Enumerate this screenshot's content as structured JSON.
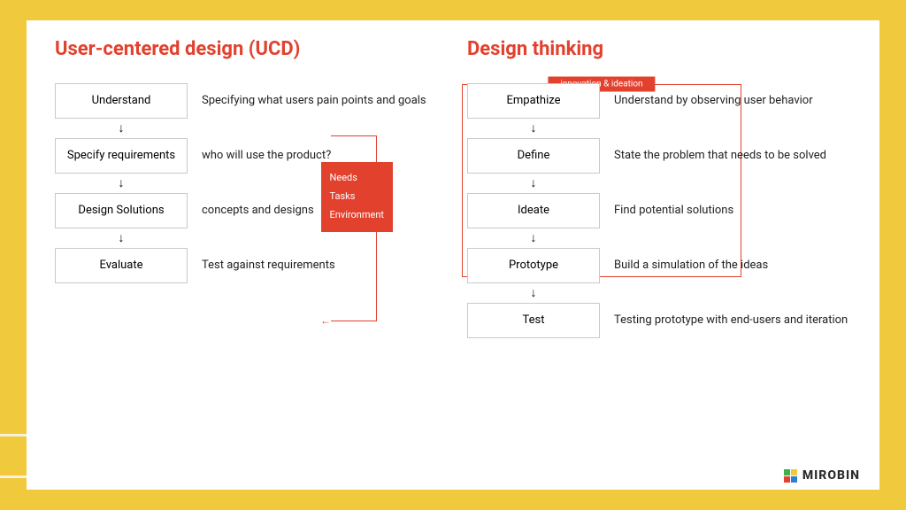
{
  "ucd": {
    "title": "User-centered design (UCD)",
    "steps": [
      {
        "label": "Understand",
        "desc": "Specifying what users pain points and goals"
      },
      {
        "label": "Specify requirements",
        "desc": "who will use the product?"
      },
      {
        "label": "Design Solutions",
        "desc": "concepts and designs"
      },
      {
        "label": "Evaluate",
        "desc": "Test against requirements"
      }
    ],
    "feedback_box": {
      "line1": "Needs",
      "line2": "Tasks",
      "line3": "Environment"
    }
  },
  "dt": {
    "title": "Design thinking",
    "group_label": "innovation & ideation",
    "steps": [
      {
        "label": "Empathize",
        "desc": "Understand by observing user behavior"
      },
      {
        "label": "Define",
        "desc": "State the problem that needs to be solved"
      },
      {
        "label": "Ideate",
        "desc": "Find potential solutions"
      },
      {
        "label": "Prototype",
        "desc": "Build a simulation of the ideas"
      },
      {
        "label": "Test",
        "desc": "Testing prototype with end-users and iteration"
      }
    ]
  },
  "brand": "MIROBIN",
  "arrow_glyph": "↓",
  "feedback_head": "←"
}
